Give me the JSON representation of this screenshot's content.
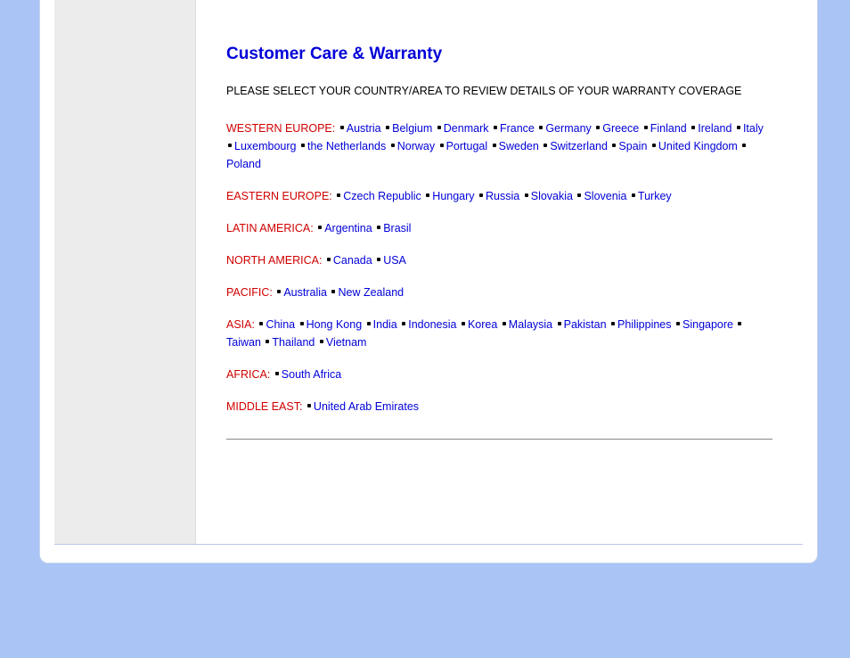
{
  "title": "Customer Care & Warranty",
  "instruction": "PLEASE SELECT YOUR COUNTRY/AREA TO REVIEW DETAILS OF YOUR WARRANTY COVERAGE",
  "regions": [
    {
      "label": "WESTERN EUROPE:",
      "countries": [
        "Austria",
        "Belgium",
        "Denmark",
        "France",
        "Germany",
        "Greece",
        "Finland",
        "Ireland",
        "Italy",
        "Luxembourg",
        "the Netherlands",
        "Norway",
        "Portugal",
        "Sweden",
        "Switzerland",
        "Spain",
        "United Kingdom",
        "Poland"
      ]
    },
    {
      "label": "EASTERN EUROPE:",
      "countries": [
        "Czech Republic",
        "Hungary",
        "Russia",
        "Slovakia",
        "Slovenia",
        "Turkey"
      ]
    },
    {
      "label": "LATIN AMERICA:",
      "countries": [
        "Argentina",
        "Brasil"
      ]
    },
    {
      "label": "NORTH AMERICA:",
      "countries": [
        "Canada",
        "USA"
      ]
    },
    {
      "label": "PACIFIC:",
      "countries": [
        "Australia",
        "New Zealand"
      ]
    },
    {
      "label": "ASIA:",
      "countries": [
        "China",
        "Hong Kong",
        "India",
        "Indonesia",
        "Korea",
        "Malaysia",
        "Pakistan",
        "Philippines",
        "Singapore",
        "Taiwan",
        "Thailand",
        "Vietnam"
      ]
    },
    {
      "label": "AFRICA:",
      "countries": [
        "South Africa"
      ]
    },
    {
      "label": "MIDDLE EAST:",
      "countries": [
        "United Arab Emirates"
      ]
    }
  ]
}
